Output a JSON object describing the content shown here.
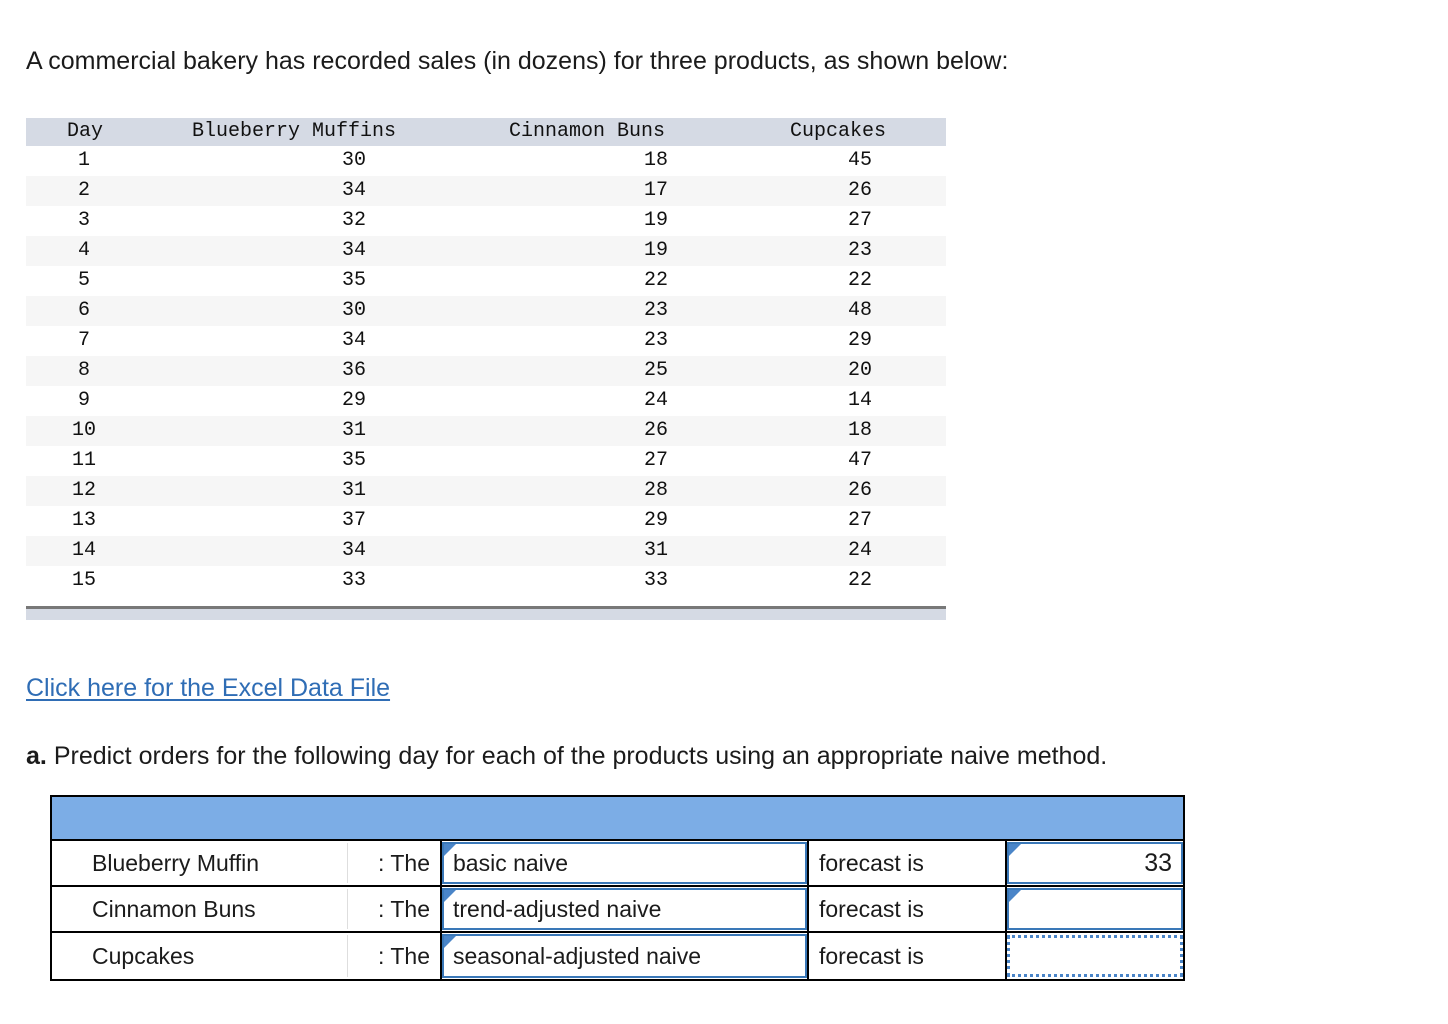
{
  "intro": {
    "text": "A commercial bakery has recorded sales (in dozens) for three products, as shown below:"
  },
  "data_table": {
    "columns": [
      "Day",
      "Blueberry Muffins",
      "Cinnamon Buns",
      "Cupcakes"
    ],
    "rows": [
      {
        "day": "1",
        "muffins": "30",
        "buns": "18",
        "cupcakes": "45"
      },
      {
        "day": "2",
        "muffins": "34",
        "buns": "17",
        "cupcakes": "26"
      },
      {
        "day": "3",
        "muffins": "32",
        "buns": "19",
        "cupcakes": "27"
      },
      {
        "day": "4",
        "muffins": "34",
        "buns": "19",
        "cupcakes": "23"
      },
      {
        "day": "5",
        "muffins": "35",
        "buns": "22",
        "cupcakes": "22"
      },
      {
        "day": "6",
        "muffins": "30",
        "buns": "23",
        "cupcakes": "48"
      },
      {
        "day": "7",
        "muffins": "34",
        "buns": "23",
        "cupcakes": "29"
      },
      {
        "day": "8",
        "muffins": "36",
        "buns": "25",
        "cupcakes": "20"
      },
      {
        "day": "9",
        "muffins": "29",
        "buns": "24",
        "cupcakes": "14"
      },
      {
        "day": "10",
        "muffins": "31",
        "buns": "26",
        "cupcakes": "18"
      },
      {
        "day": "11",
        "muffins": "35",
        "buns": "27",
        "cupcakes": "47"
      },
      {
        "day": "12",
        "muffins": "31",
        "buns": "28",
        "cupcakes": "26"
      },
      {
        "day": "13",
        "muffins": "37",
        "buns": "29",
        "cupcakes": "27"
      },
      {
        "day": "14",
        "muffins": "34",
        "buns": "31",
        "cupcakes": "24"
      },
      {
        "day": "15",
        "muffins": "33",
        "buns": "33",
        "cupcakes": "22"
      }
    ]
  },
  "excel_link": {
    "label": "Click here for the Excel Data File"
  },
  "question_a": {
    "label": "a.",
    "text": "Predict orders for the following day for each of the products using an appropriate naive method."
  },
  "answer_form": {
    "rows": [
      {
        "product": "Blueberry Muffin",
        "connector": ": The",
        "method": "basic naive",
        "static": "forecast is",
        "answer": "33"
      },
      {
        "product": "Cinnamon Buns",
        "connector": ": The",
        "method": "trend-adjusted naive",
        "static": "forecast is",
        "answer": ""
      },
      {
        "product": "Cupcakes",
        "connector": ": The",
        "method": "seasonal-adjusted naive",
        "static": "forecast is",
        "answer": ""
      }
    ]
  },
  "colors": {
    "form_header_blue": "#7cade6",
    "input_border_blue": "#3a78b8",
    "selected_dotted_blue": "#4a85c8",
    "table_header_grey": "#d5dae4",
    "link_blue": "#2f6db5",
    "zebra_grey": "#f6f6f6"
  }
}
